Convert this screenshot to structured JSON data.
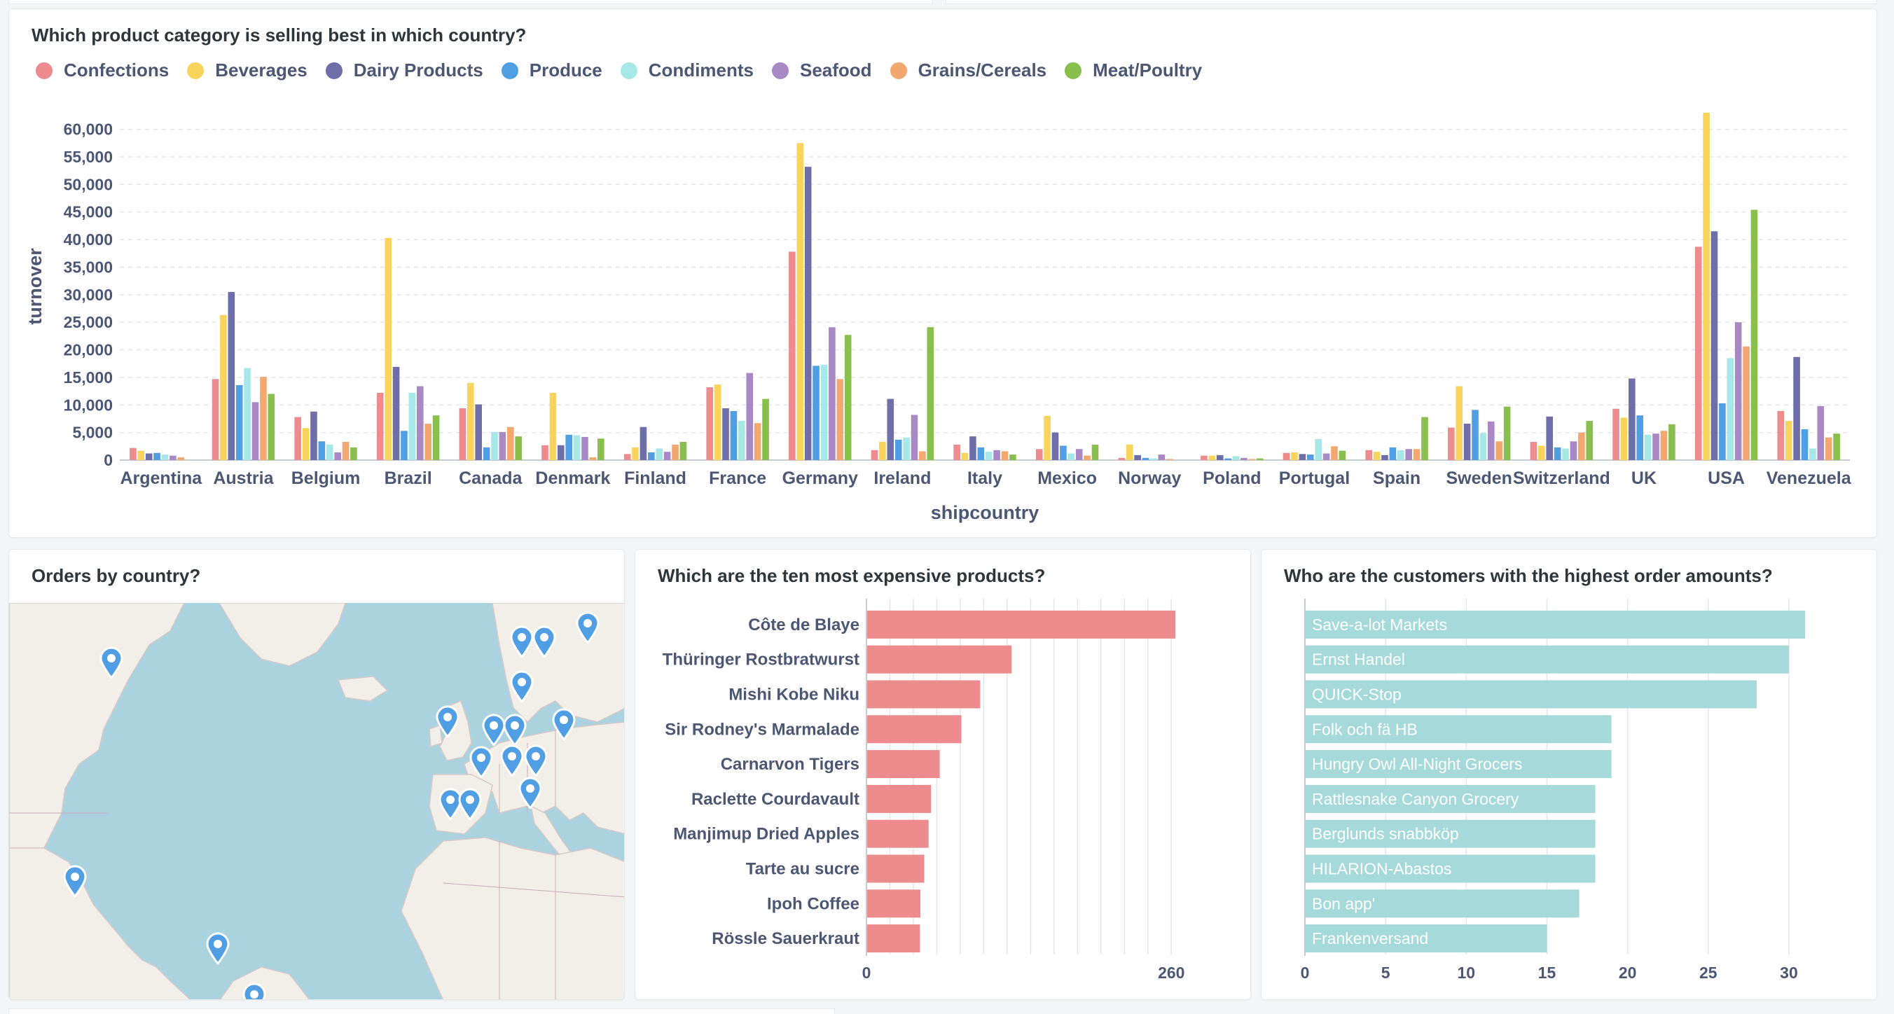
{
  "main_card": {
    "title": "Which product category is selling best in which country?",
    "chart_data": {
      "type": "bar",
      "xlabel": "shipcountry",
      "ylabel": "turnover",
      "ylim": [
        0,
        63000
      ],
      "yticks": [
        "0",
        "5,000",
        "10,000",
        "15,000",
        "20,000",
        "25,000",
        "30,000",
        "35,000",
        "40,000",
        "45,000",
        "50,000",
        "55,000",
        "60,000"
      ],
      "grid": true,
      "legend_position": "top-left",
      "categories": [
        "Argentina",
        "Austria",
        "Belgium",
        "Brazil",
        "Canada",
        "Denmark",
        "Finland",
        "France",
        "Germany",
        "Ireland",
        "Italy",
        "Mexico",
        "Norway",
        "Poland",
        "Portugal",
        "Spain",
        "Sweden",
        "Switzerland",
        "UK",
        "USA",
        "Venezuela"
      ],
      "series": [
        {
          "name": "Confections",
          "color": "#ed8b8f",
          "values": [
            2200,
            14700,
            7800,
            12200,
            9400,
            2700,
            1100,
            13200,
            37800,
            1800,
            2800,
            2000,
            400,
            800,
            1300,
            1800,
            5900,
            3300,
            9300,
            38700,
            8900
          ]
        },
        {
          "name": "Beverages",
          "color": "#f9d45c",
          "values": [
            1700,
            26300,
            5800,
            40300,
            14000,
            12200,
            2300,
            13700,
            57500,
            3300,
            1300,
            8000,
            2800,
            800,
            1400,
            1500,
            13400,
            2600,
            7700,
            63000,
            7100
          ]
        },
        {
          "name": "Dairy Products",
          "color": "#6e6ea8",
          "values": [
            1200,
            30500,
            8800,
            16900,
            10100,
            2700,
            6000,
            9400,
            53200,
            11100,
            4300,
            5000,
            900,
            900,
            1100,
            900,
            6600,
            7900,
            14800,
            41500,
            18700
          ]
        },
        {
          "name": "Produce",
          "color": "#509ee3",
          "values": [
            1300,
            13600,
            3400,
            5300,
            2300,
            4600,
            1400,
            8900,
            17100,
            3700,
            2300,
            2600,
            400,
            300,
            1000,
            2300,
            9100,
            2300,
            8100,
            10300,
            5600
          ]
        },
        {
          "name": "Condiments",
          "color": "#a6e7e7",
          "values": [
            1000,
            16700,
            2800,
            12200,
            5100,
            4500,
            2100,
            7100,
            17300,
            4100,
            1500,
            1200,
            300,
            700,
            3800,
            1800,
            4900,
            2100,
            4600,
            18500,
            2100
          ]
        },
        {
          "name": "Seafood",
          "color": "#a989c5",
          "values": [
            800,
            10500,
            1400,
            13400,
            5100,
            4200,
            1500,
            15800,
            24100,
            8200,
            1800,
            2000,
            1000,
            400,
            1200,
            2000,
            7000,
            3400,
            4800,
            25000,
            9800
          ]
        },
        {
          "name": "Grains/Cereals",
          "color": "#f2a86f",
          "values": [
            500,
            15100,
            3300,
            6600,
            6000,
            500,
            2800,
            6700,
            14700,
            1600,
            1600,
            800,
            200,
            200,
            2500,
            2000,
            3400,
            5000,
            5300,
            20600,
            4100
          ]
        },
        {
          "name": "Meat/Poultry",
          "color": "#88bf4d",
          "values": [
            0,
            12000,
            2300,
            8100,
            4300,
            3900,
            3300,
            11100,
            22700,
            24100,
            1000,
            2800,
            0,
            300,
            1700,
            7800,
            9700,
            7100,
            6500,
            45400,
            4800
          ]
        }
      ]
    }
  },
  "map_card": {
    "title": "Orders by country?"
  },
  "products_card": {
    "title": "Which are the ten most expensive products?",
    "chart_data": {
      "type": "bar",
      "orientation": "horizontal",
      "color": "#ed8b8f",
      "categories": [
        "Côte de Blaye",
        "Thüringer Rostbratwurst",
        "Mishi Kobe Niku",
        "Sir Rodney's Marmalade",
        "Carnarvon Tigers",
        "Raclette Courdavault",
        "Manjimup Dried Apples",
        "Tarte au sucre",
        "Ipoh Coffee",
        "Rössle Sauerkraut"
      ],
      "values": [
        263.5,
        123.79,
        97,
        81,
        62.5,
        55,
        53,
        49.3,
        46,
        45.6
      ],
      "xlim": [
        0,
        270
      ],
      "xticks": [
        "0",
        "260"
      ]
    }
  },
  "customers_card": {
    "title": "Who are the customers with the highest order amounts?",
    "chart_data": {
      "type": "bar",
      "orientation": "horizontal",
      "color": "#a6d9d9",
      "categories": [
        "Save-a-lot Markets",
        "Ernst Handel",
        "QUICK-Stop",
        "Folk och fä HB",
        "Hungry Owl All-Night Grocers",
        "Rattlesnake Canyon Grocery",
        "Berglunds snabbköp",
        "HILARION-Abastos",
        "Bon app'",
        "Frankenversand"
      ],
      "values": [
        31,
        30,
        28,
        19,
        19,
        18,
        18,
        18,
        17,
        15
      ],
      "xlim": [
        0,
        31
      ],
      "xticks": [
        "0",
        "5",
        "10",
        "15",
        "20",
        "25",
        "30"
      ]
    }
  }
}
